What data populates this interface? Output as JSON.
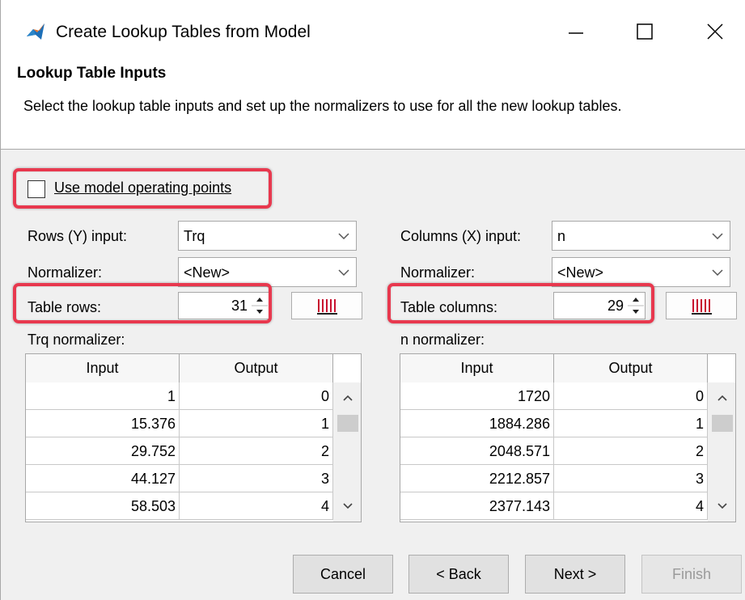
{
  "window": {
    "title": "Create Lookup Tables from Model",
    "app_icon": "matlab-icon",
    "controls": [
      "minimize-icon",
      "maximize-icon",
      "close-icon"
    ]
  },
  "header": {
    "title": "Lookup Table Inputs",
    "description": "Select the lookup table inputs and set up the normalizers to use for all the new lookup tables."
  },
  "options": {
    "use_operating_points_label": "Use model operating points",
    "use_operating_points_checked": false
  },
  "rows_panel": {
    "input_label": "Rows (Y) input:",
    "input_value": "Trq",
    "normalizer_label": "Normalizer:",
    "normalizer_value": "<New>",
    "count_label": "Table rows:",
    "count_value": "31",
    "color_button_icon": "bars-icon",
    "table_label": "Trq normalizer:",
    "columns": [
      "Input",
      "Output"
    ],
    "rows": [
      [
        "1",
        "0"
      ],
      [
        "15.376",
        "1"
      ],
      [
        "29.752",
        "2"
      ],
      [
        "44.127",
        "3"
      ],
      [
        "58.503",
        "4"
      ]
    ]
  },
  "cols_panel": {
    "input_label": "Columns (X) input:",
    "input_value": "n",
    "normalizer_label": "Normalizer:",
    "normalizer_value": "<New>",
    "count_label": "Table columns:",
    "count_value": "29",
    "color_button_icon": "bars-icon",
    "table_label": "n normalizer:",
    "columns": [
      "Input",
      "Output"
    ],
    "rows": [
      [
        "1720",
        "0"
      ],
      [
        "1884.286",
        "1"
      ],
      [
        "2048.571",
        "2"
      ],
      [
        "2212.857",
        "3"
      ],
      [
        "2377.143",
        "4"
      ]
    ]
  },
  "footer": {
    "cancel_label": "Cancel",
    "back_label": "< Back",
    "next_label": "Next >",
    "finish_label": "Finish",
    "finish_enabled": false
  },
  "colors": {
    "highlight": "#e8384e",
    "panel_bg": "#f0f0f0",
    "icon_red": "#c8102e"
  }
}
